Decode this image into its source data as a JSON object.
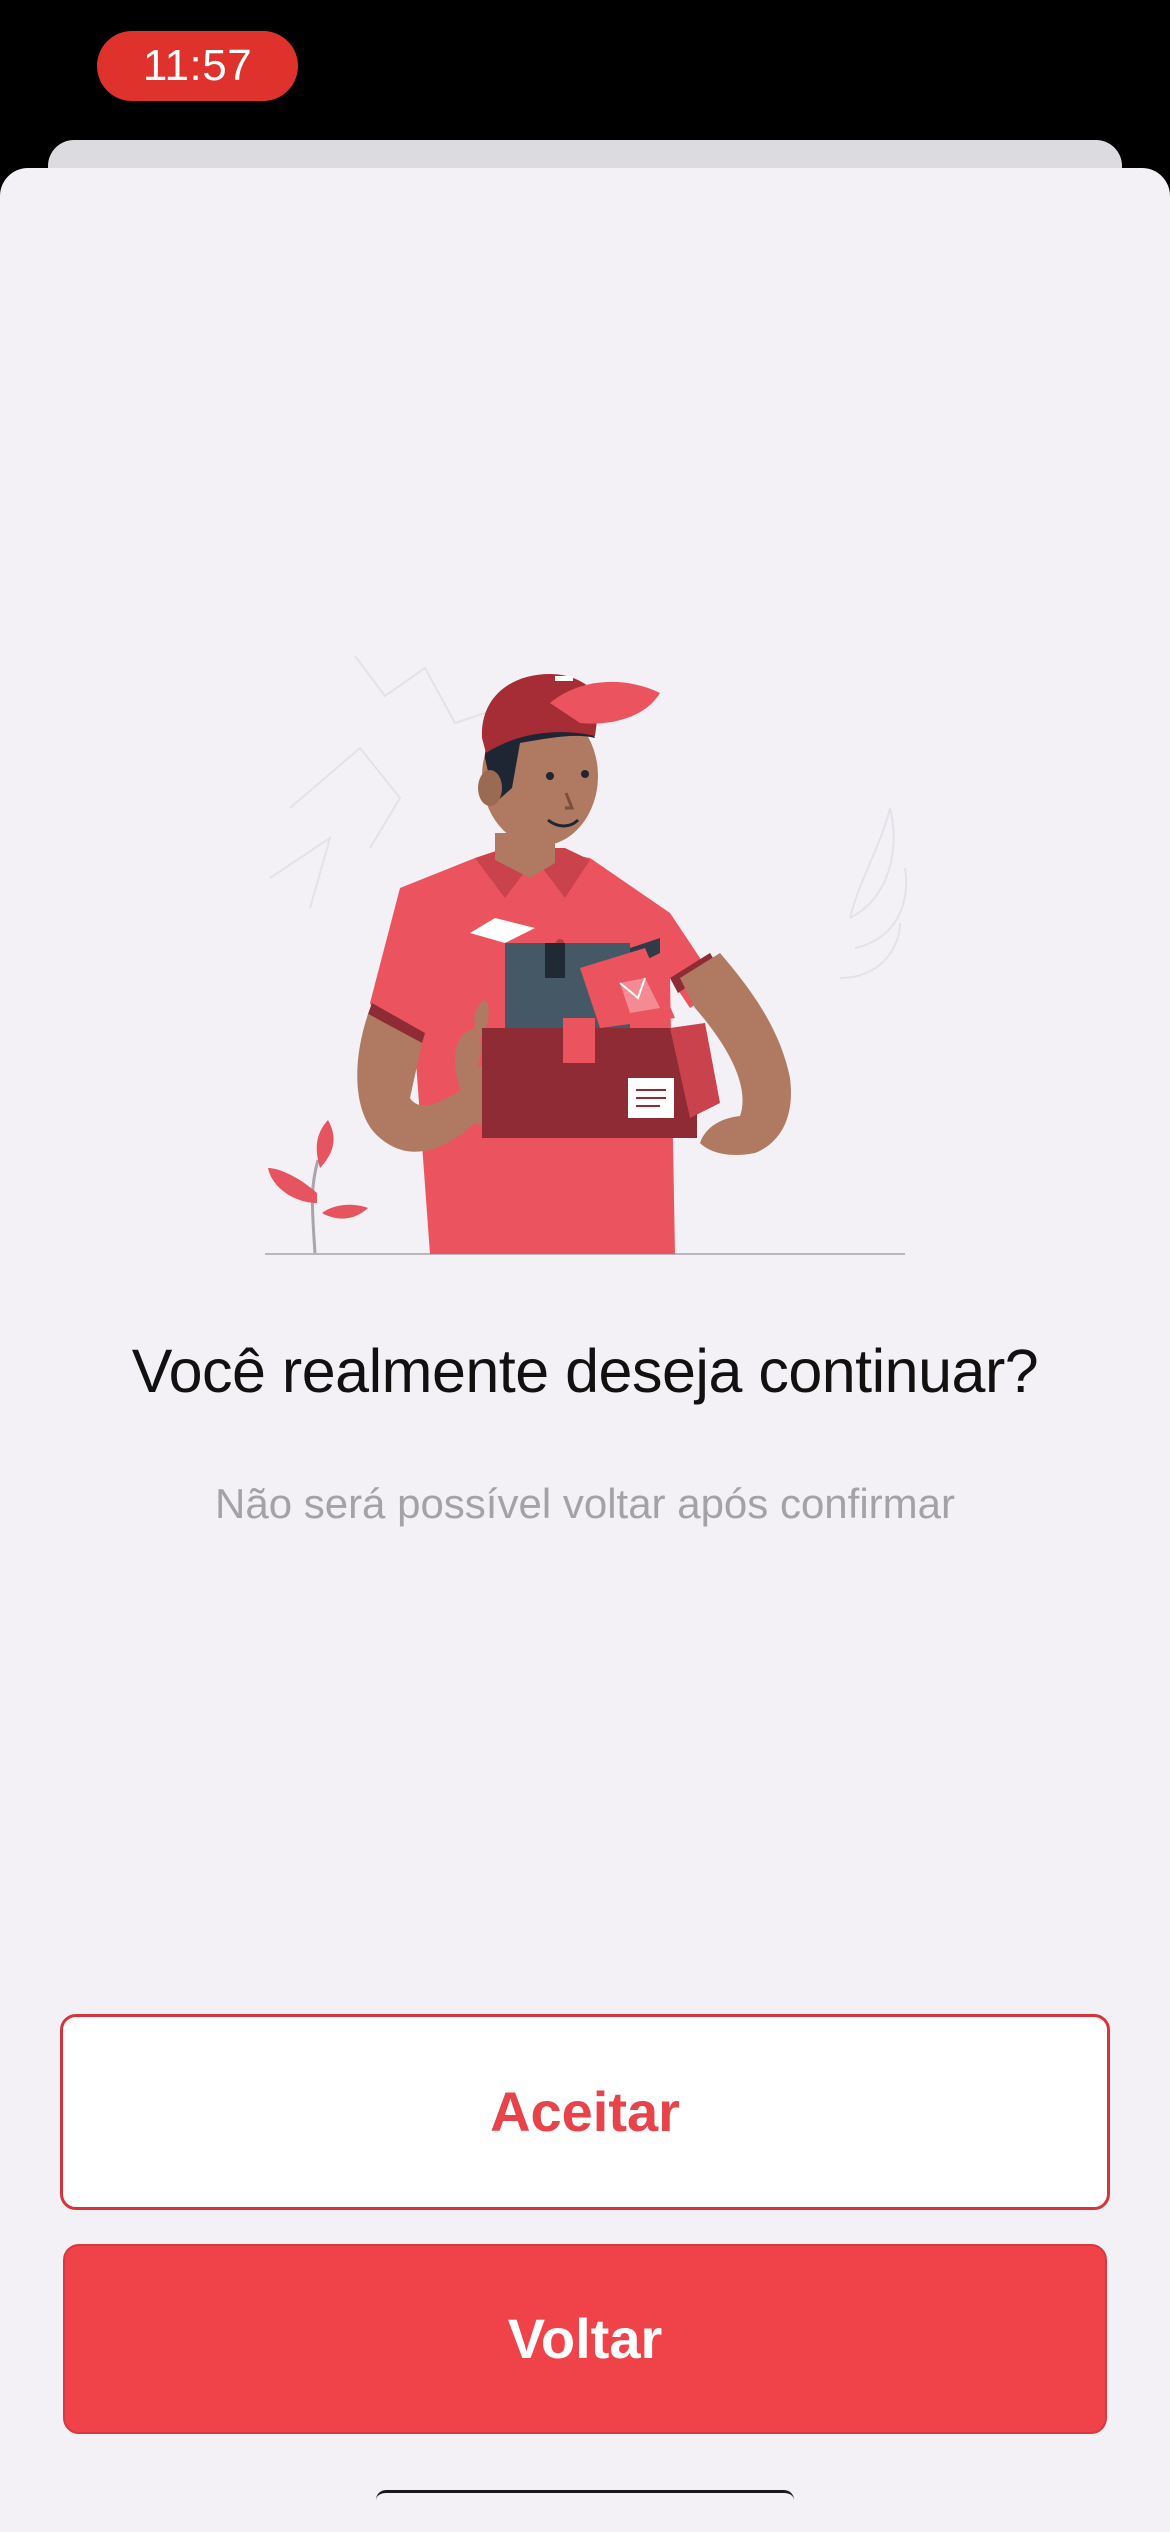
{
  "status_bar": {
    "time": "11:57",
    "time_pill_color": "#e0322c"
  },
  "dialog": {
    "illustration": "delivery-person-holding-packages",
    "title": "Você realmente deseja continuar?",
    "subtitle": "Não será possível voltar após confirmar",
    "accept_label": "Aceitar",
    "back_label": "Voltar"
  },
  "colors": {
    "accent": "#f04349",
    "accent_text": "#e8434a",
    "background": "#f3f1f5",
    "subtitle": "#a3a2a7"
  }
}
